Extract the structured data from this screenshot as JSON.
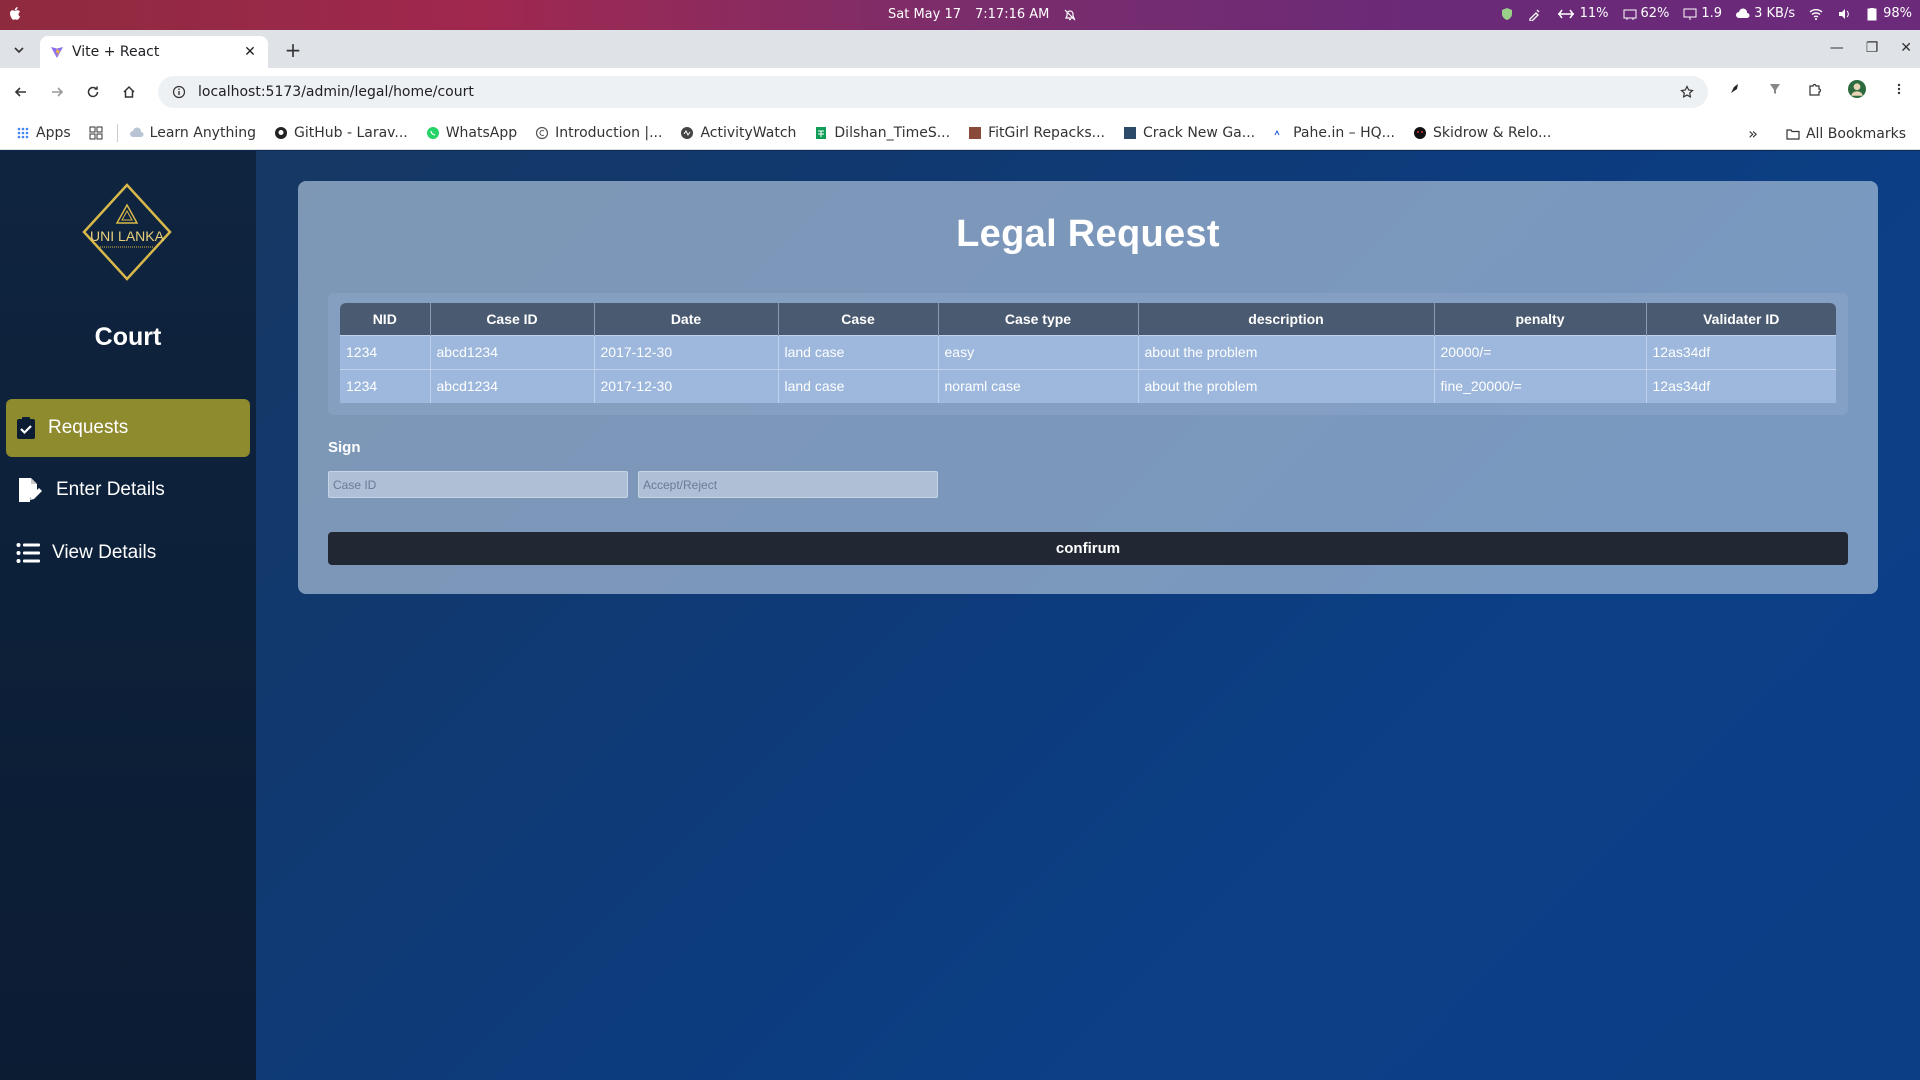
{
  "os": {
    "date": "Sat May 17",
    "time": "7:17:16 AM",
    "cpu": "11%",
    "mem": "62%",
    "load": "1.9",
    "net": "3 KB/s",
    "battery": "98%"
  },
  "browser": {
    "tab_title": "Vite + React",
    "url": "localhost:5173/admin/legal/home/court",
    "bookmarks": [
      "Apps",
      "Learn Anything",
      "GitHub - Larav...",
      "WhatsApp",
      "Introduction |...",
      "ActivityWatch",
      "Dilshan_TimeS...",
      "FitGirl Repacks...",
      "Crack New Ga...",
      "Pahe.in – HQ...",
      "Skidrow & Relo..."
    ],
    "all_bookmarks": "All Bookmarks"
  },
  "sidebar": {
    "logo_text": "UNI LANKA",
    "title": "Court",
    "items": [
      {
        "label": "Requests",
        "icon": "clipboard-check-icon"
      },
      {
        "label": "Enter Details",
        "icon": "file-pen-icon"
      },
      {
        "label": "View Details",
        "icon": "list-icon"
      }
    ]
  },
  "main": {
    "title": "Legal Request",
    "table": {
      "headers": [
        "NID",
        "Case ID",
        "Date",
        "Case",
        "Case type",
        "description",
        "penalty",
        "Validater ID"
      ],
      "rows": [
        [
          "1234",
          "abcd1234",
          "2017-12-30",
          "land case",
          "easy",
          "about the problem",
          "20000/=",
          "12as34df"
        ],
        [
          "1234",
          "abcd1234",
          "2017-12-30",
          "land case",
          "noraml case",
          "about the problem",
          "fine_20000/=",
          "12as34df"
        ]
      ]
    },
    "sign_label": "Sign",
    "case_id_placeholder": "Case ID",
    "decision_placeholder": "Accept/Reject",
    "confirm_label": "confirum"
  },
  "colors": {
    "sidebar_active": "#8e8a2e",
    "confirm_bg": "#222833",
    "header_bg": "#4a5a70"
  }
}
